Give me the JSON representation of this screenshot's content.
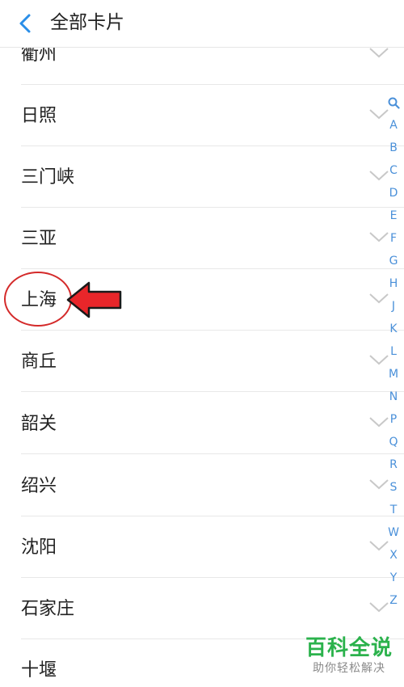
{
  "header": {
    "title": "全部卡片"
  },
  "cities": [
    {
      "name": "衢州"
    },
    {
      "name": "日照"
    },
    {
      "name": "三门峡"
    },
    {
      "name": "三亚"
    },
    {
      "name": "上海"
    },
    {
      "name": "商丘"
    },
    {
      "name": "韶关"
    },
    {
      "name": "绍兴"
    },
    {
      "name": "沈阳"
    },
    {
      "name": "石家庄"
    },
    {
      "name": "十堰"
    }
  ],
  "index": [
    "A",
    "B",
    "C",
    "D",
    "E",
    "F",
    "G",
    "H",
    "J",
    "K",
    "L",
    "M",
    "N",
    "P",
    "Q",
    "R",
    "S",
    "T",
    "W",
    "X",
    "Y",
    "Z"
  ],
  "watermark": {
    "main": "百科全说",
    "sub": "助你轻松解决"
  },
  "colors": {
    "accent": "#4a90d9",
    "annotation": "#d42a2a",
    "watermark": "#2bb24c"
  }
}
